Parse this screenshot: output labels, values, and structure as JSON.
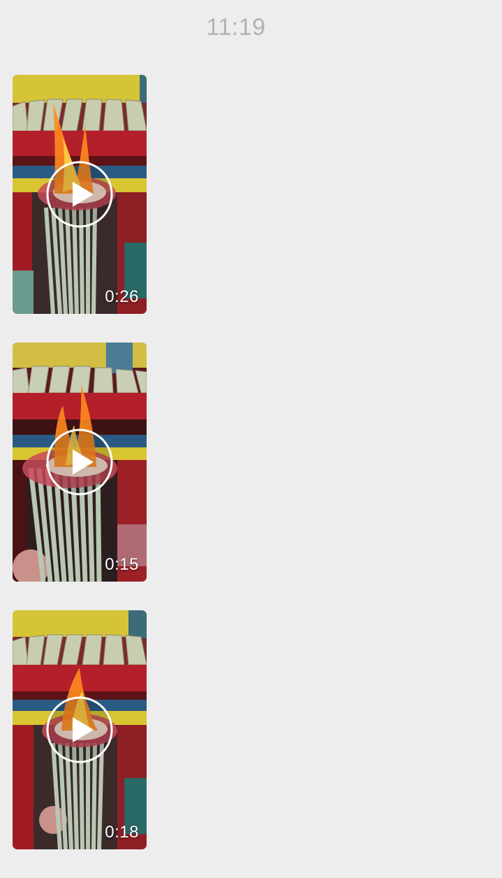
{
  "chat": {
    "timestamp": "11:19"
  },
  "videos": [
    {
      "duration": "0:26",
      "icon": "play-icon"
    },
    {
      "duration": "0:15",
      "icon": "play-icon"
    },
    {
      "duration": "0:18",
      "icon": "play-icon"
    }
  ],
  "colors": {
    "background": "#ededed",
    "timestamp": "#b2b2b2",
    "temple_red": "#b3202a",
    "temple_yellow": "#d9c531",
    "incense": "#b8c7b4",
    "flame": "#ff8a1f"
  }
}
